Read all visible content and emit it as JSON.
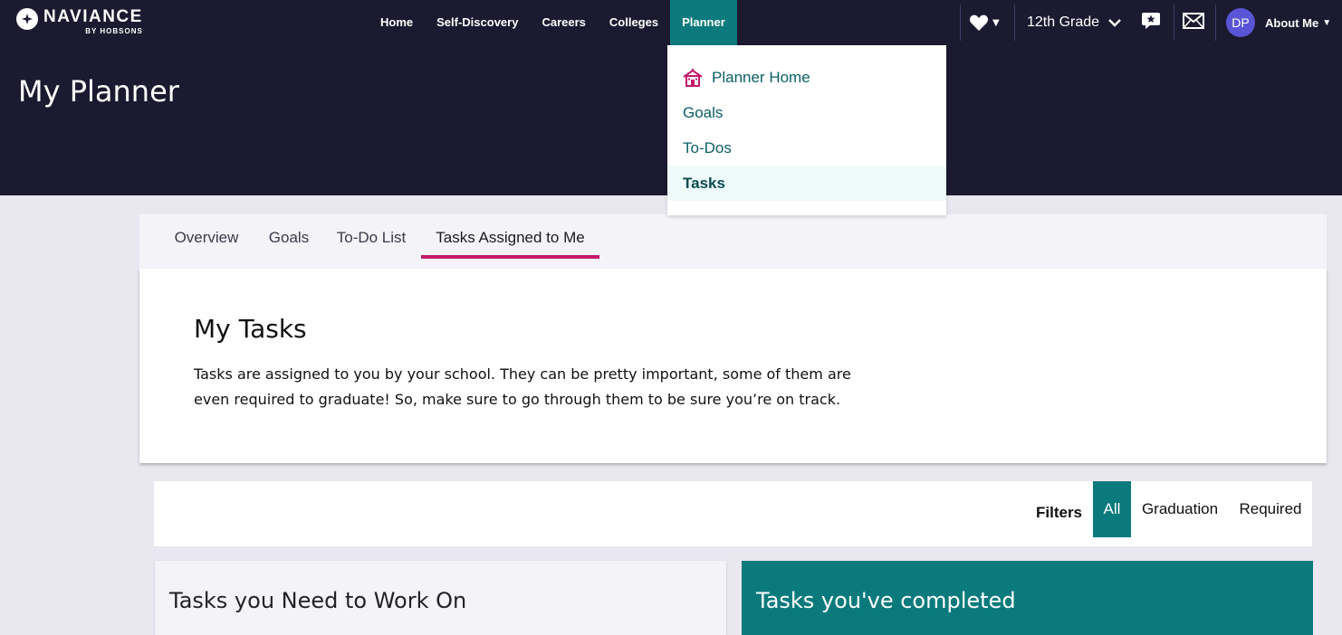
{
  "brand": {
    "name": "NAVIANCE",
    "sub": "BY HOBSONS"
  },
  "nav": [
    "Home",
    "Self-Discovery",
    "Careers",
    "Colleges",
    "Planner"
  ],
  "nav_active": "Planner",
  "util": {
    "grade": "12th Grade",
    "avatar_initials": "DP",
    "about_me": "About Me"
  },
  "page_title": "My Planner",
  "dropdown": {
    "items": [
      "Planner Home",
      "Goals",
      "To-Dos",
      "Tasks"
    ],
    "active": "Tasks"
  },
  "tabs": [
    "Overview",
    "Goals",
    "To-Do List",
    "Tasks Assigned to Me"
  ],
  "tabs_active": "Tasks Assigned to Me",
  "tasks_card": {
    "title": "My Tasks",
    "description": "Tasks are assigned to you by your school. They can be pretty important, some of them are even required to graduate! So, make sure to go through them to be sure you’re on track."
  },
  "filters": {
    "label": "Filters",
    "options": [
      "All",
      "Graduation",
      "Required"
    ],
    "active": "All"
  },
  "columns": {
    "left_title": "Tasks you Need to Work On",
    "right_title": "Tasks you've completed"
  },
  "colors": {
    "nav_bg": "#1b1a30",
    "accent_teal": "#0b7a7c",
    "tab_underline": "#c4196b"
  }
}
